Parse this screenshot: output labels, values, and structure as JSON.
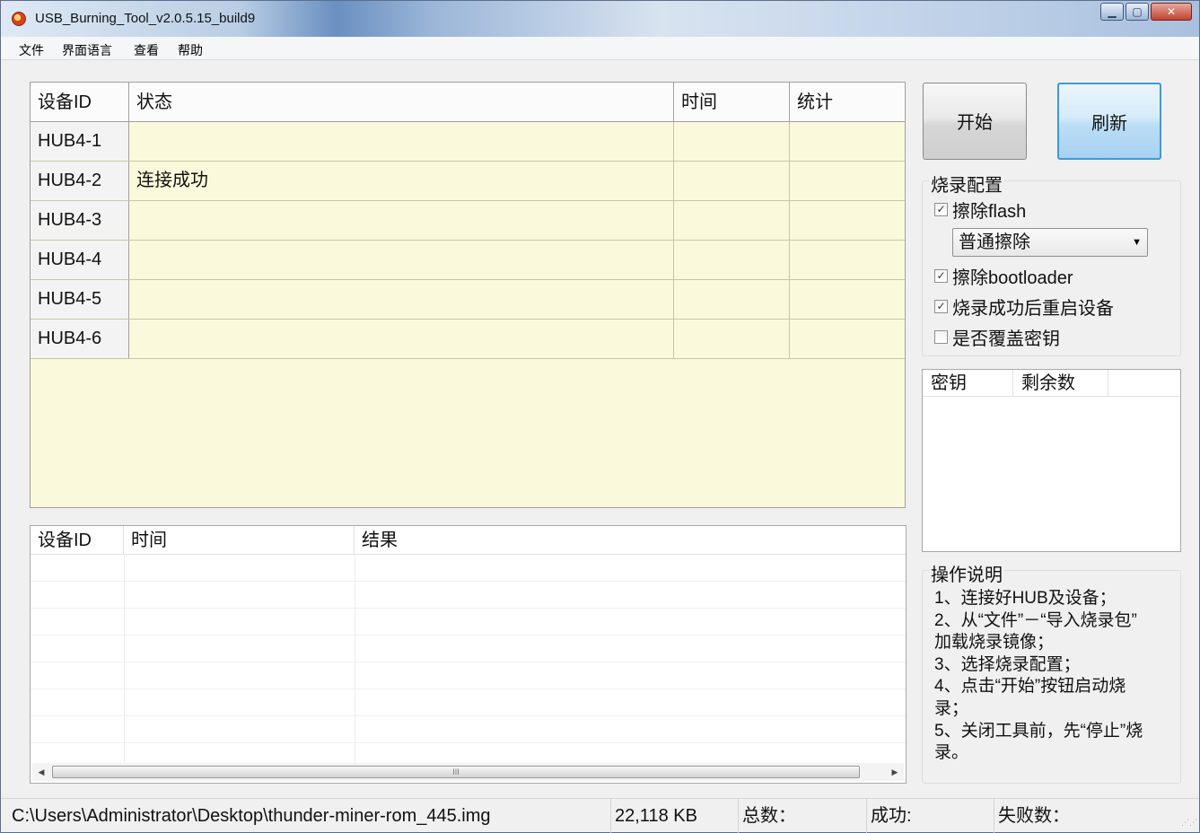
{
  "window": {
    "title": "USB_Burning_Tool_v2.0.5.15_build9"
  },
  "menu": [
    "文件",
    "界面语言",
    "查看",
    "帮助"
  ],
  "device_table": {
    "columns": [
      "设备ID",
      "状态",
      "时间",
      "统计"
    ],
    "rows": [
      {
        "id": "HUB4-1",
        "status": "",
        "time": "",
        "stat": ""
      },
      {
        "id": "HUB4-2",
        "status": "连接成功",
        "time": "",
        "stat": ""
      },
      {
        "id": "HUB4-3",
        "status": "",
        "time": "",
        "stat": ""
      },
      {
        "id": "HUB4-4",
        "status": "",
        "time": "",
        "stat": ""
      },
      {
        "id": "HUB4-5",
        "status": "",
        "time": "",
        "stat": ""
      },
      {
        "id": "HUB4-6",
        "status": "",
        "time": "",
        "stat": ""
      }
    ]
  },
  "result_list": {
    "columns": [
      "设备ID",
      "时间",
      "结果"
    ],
    "scroll_marker": "III"
  },
  "buttons": {
    "start": "开始",
    "refresh": "刷新"
  },
  "burn_config": {
    "title": "烧录配置",
    "erase_flash": {
      "label": "擦除flash",
      "checked": true
    },
    "erase_mode": "普通擦除",
    "erase_bootloader": {
      "label": "擦除bootloader",
      "checked": true
    },
    "reboot_after": {
      "label": "烧录成功后重启设备",
      "checked": true
    },
    "overwrite_key": {
      "label": "是否覆盖密钥",
      "checked": false
    }
  },
  "key_list": {
    "columns": [
      "密钥",
      "剩余数"
    ]
  },
  "instructions": {
    "title": "操作说明",
    "lines": [
      "1、连接好HUB及设备；",
      "2、从“文件”－“导入烧录包”",
      "加载烧录镜像；",
      "3、选择烧录配置；",
      "4、点击“开始”按钮启动烧",
      "录；",
      "5、关闭工具前，先“停止”烧",
      "录。"
    ]
  },
  "status_bar": {
    "file_path": "C:\\Users\\Administrator\\Desktop\\thunder-miner-rom_445.img",
    "file_size": "22,118 KB",
    "total_label": "总数：",
    "success_label": "成功:",
    "fail_label": "失败数："
  }
}
